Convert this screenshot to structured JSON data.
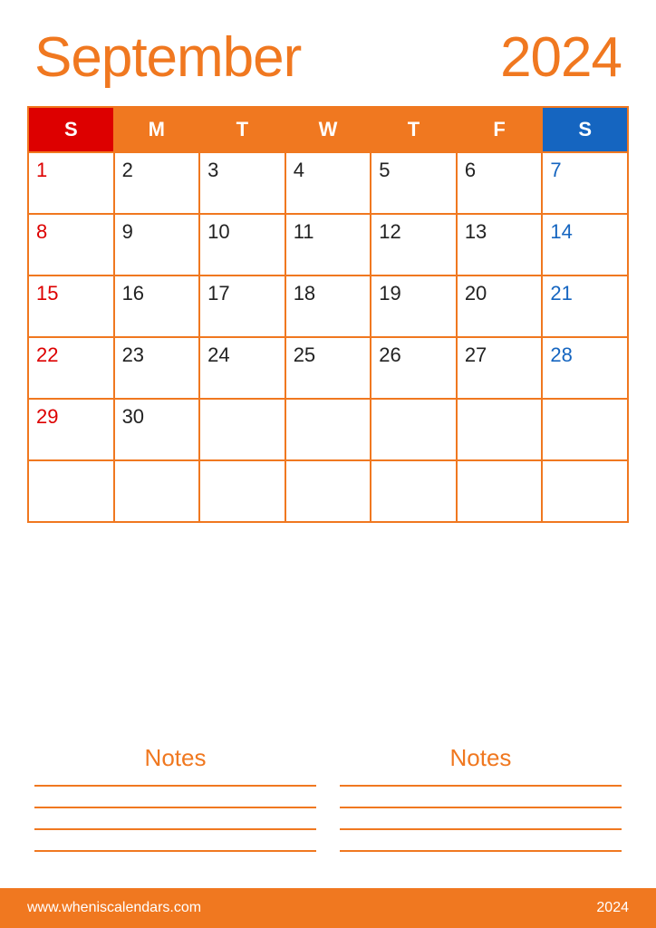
{
  "header": {
    "month": "September",
    "year": "2024"
  },
  "days_header": [
    {
      "label": "S",
      "type": "sunday"
    },
    {
      "label": "M",
      "type": "weekday"
    },
    {
      "label": "T",
      "type": "weekday"
    },
    {
      "label": "W",
      "type": "weekday"
    },
    {
      "label": "T",
      "type": "weekday"
    },
    {
      "label": "F",
      "type": "weekday"
    },
    {
      "label": "S",
      "type": "saturday"
    }
  ],
  "weeks": [
    [
      {
        "day": "1",
        "type": "sunday"
      },
      {
        "day": "2",
        "type": "weekday"
      },
      {
        "day": "3",
        "type": "weekday"
      },
      {
        "day": "4",
        "type": "weekday"
      },
      {
        "day": "5",
        "type": "weekday"
      },
      {
        "day": "6",
        "type": "weekday"
      },
      {
        "day": "7",
        "type": "saturday"
      }
    ],
    [
      {
        "day": "8",
        "type": "sunday"
      },
      {
        "day": "9",
        "type": "weekday"
      },
      {
        "day": "10",
        "type": "weekday"
      },
      {
        "day": "11",
        "type": "weekday"
      },
      {
        "day": "12",
        "type": "weekday"
      },
      {
        "day": "13",
        "type": "weekday"
      },
      {
        "day": "14",
        "type": "saturday"
      }
    ],
    [
      {
        "day": "15",
        "type": "sunday"
      },
      {
        "day": "16",
        "type": "weekday"
      },
      {
        "day": "17",
        "type": "weekday"
      },
      {
        "day": "18",
        "type": "weekday"
      },
      {
        "day": "19",
        "type": "weekday"
      },
      {
        "day": "20",
        "type": "weekday"
      },
      {
        "day": "21",
        "type": "saturday"
      }
    ],
    [
      {
        "day": "22",
        "type": "sunday"
      },
      {
        "day": "23",
        "type": "weekday"
      },
      {
        "day": "24",
        "type": "weekday"
      },
      {
        "day": "25",
        "type": "weekday"
      },
      {
        "day": "26",
        "type": "weekday"
      },
      {
        "day": "27",
        "type": "weekday"
      },
      {
        "day": "28",
        "type": "saturday"
      }
    ],
    [
      {
        "day": "29",
        "type": "sunday"
      },
      {
        "day": "30",
        "type": "weekday"
      },
      {
        "day": "",
        "type": "empty"
      },
      {
        "day": "",
        "type": "empty"
      },
      {
        "day": "",
        "type": "empty"
      },
      {
        "day": "",
        "type": "empty"
      },
      {
        "day": "",
        "type": "empty"
      }
    ],
    [
      {
        "day": "",
        "type": "empty"
      },
      {
        "day": "",
        "type": "empty"
      },
      {
        "day": "",
        "type": "empty"
      },
      {
        "day": "",
        "type": "empty"
      },
      {
        "day": "",
        "type": "empty"
      },
      {
        "day": "",
        "type": "empty"
      },
      {
        "day": "",
        "type": "empty"
      }
    ]
  ],
  "notes": {
    "left_title": "Notes",
    "right_title": "Notes",
    "lines_count": 4
  },
  "footer": {
    "url": "www.wheniscalendars.com",
    "year": "2024"
  }
}
